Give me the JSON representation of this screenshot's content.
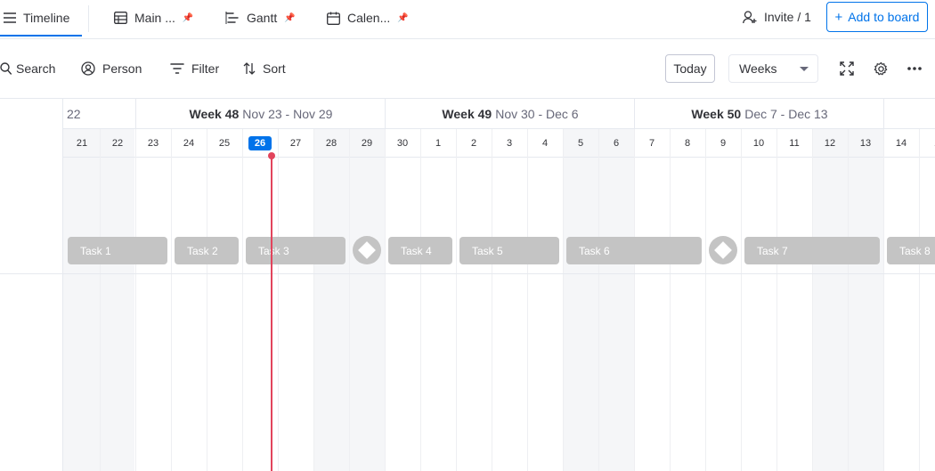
{
  "tabs": [
    {
      "label": "Timeline",
      "icon": "menu-lines-icon",
      "active": true
    },
    {
      "label": "Main ...",
      "icon": "table-icon",
      "pinned": true
    },
    {
      "label": "Gantt",
      "icon": "gantt-icon",
      "pinned": true
    },
    {
      "label": "Calen...",
      "icon": "calendar-icon",
      "pinned": true
    }
  ],
  "header": {
    "invite_label": "Invite / 1",
    "add_to_board_label": "Add to board"
  },
  "toolbar": {
    "search_label": "Search",
    "person_label": "Person",
    "filter_label": "Filter",
    "sort_label": "Sort",
    "today_label": "Today",
    "view_select_value": "Weeks"
  },
  "timeline": {
    "partial_week_label": "22",
    "weeks": [
      {
        "name": "Week 48",
        "range": "Nov 23 - Nov 29"
      },
      {
        "name": "Week 49",
        "range": "Nov 30 - Dec 6"
      },
      {
        "name": "Week 50",
        "range": "Dec 7 - Dec 13"
      }
    ],
    "days": [
      "21",
      "22",
      "23",
      "24",
      "25",
      "26",
      "27",
      "28",
      "29",
      "30",
      "1",
      "2",
      "3",
      "4",
      "5",
      "6",
      "7",
      "8",
      "9",
      "10",
      "11",
      "12",
      "13",
      "14",
      "1"
    ],
    "today": "26",
    "tasks": [
      "Task 1",
      "Task 2",
      "Task 3",
      "Task 4",
      "Task 5",
      "Task 6",
      "Task 7",
      "Task 8"
    ]
  },
  "colors": {
    "accent": "#0073ea",
    "today_marker": "#e2445c",
    "task_bar": "#c4c4c4"
  }
}
